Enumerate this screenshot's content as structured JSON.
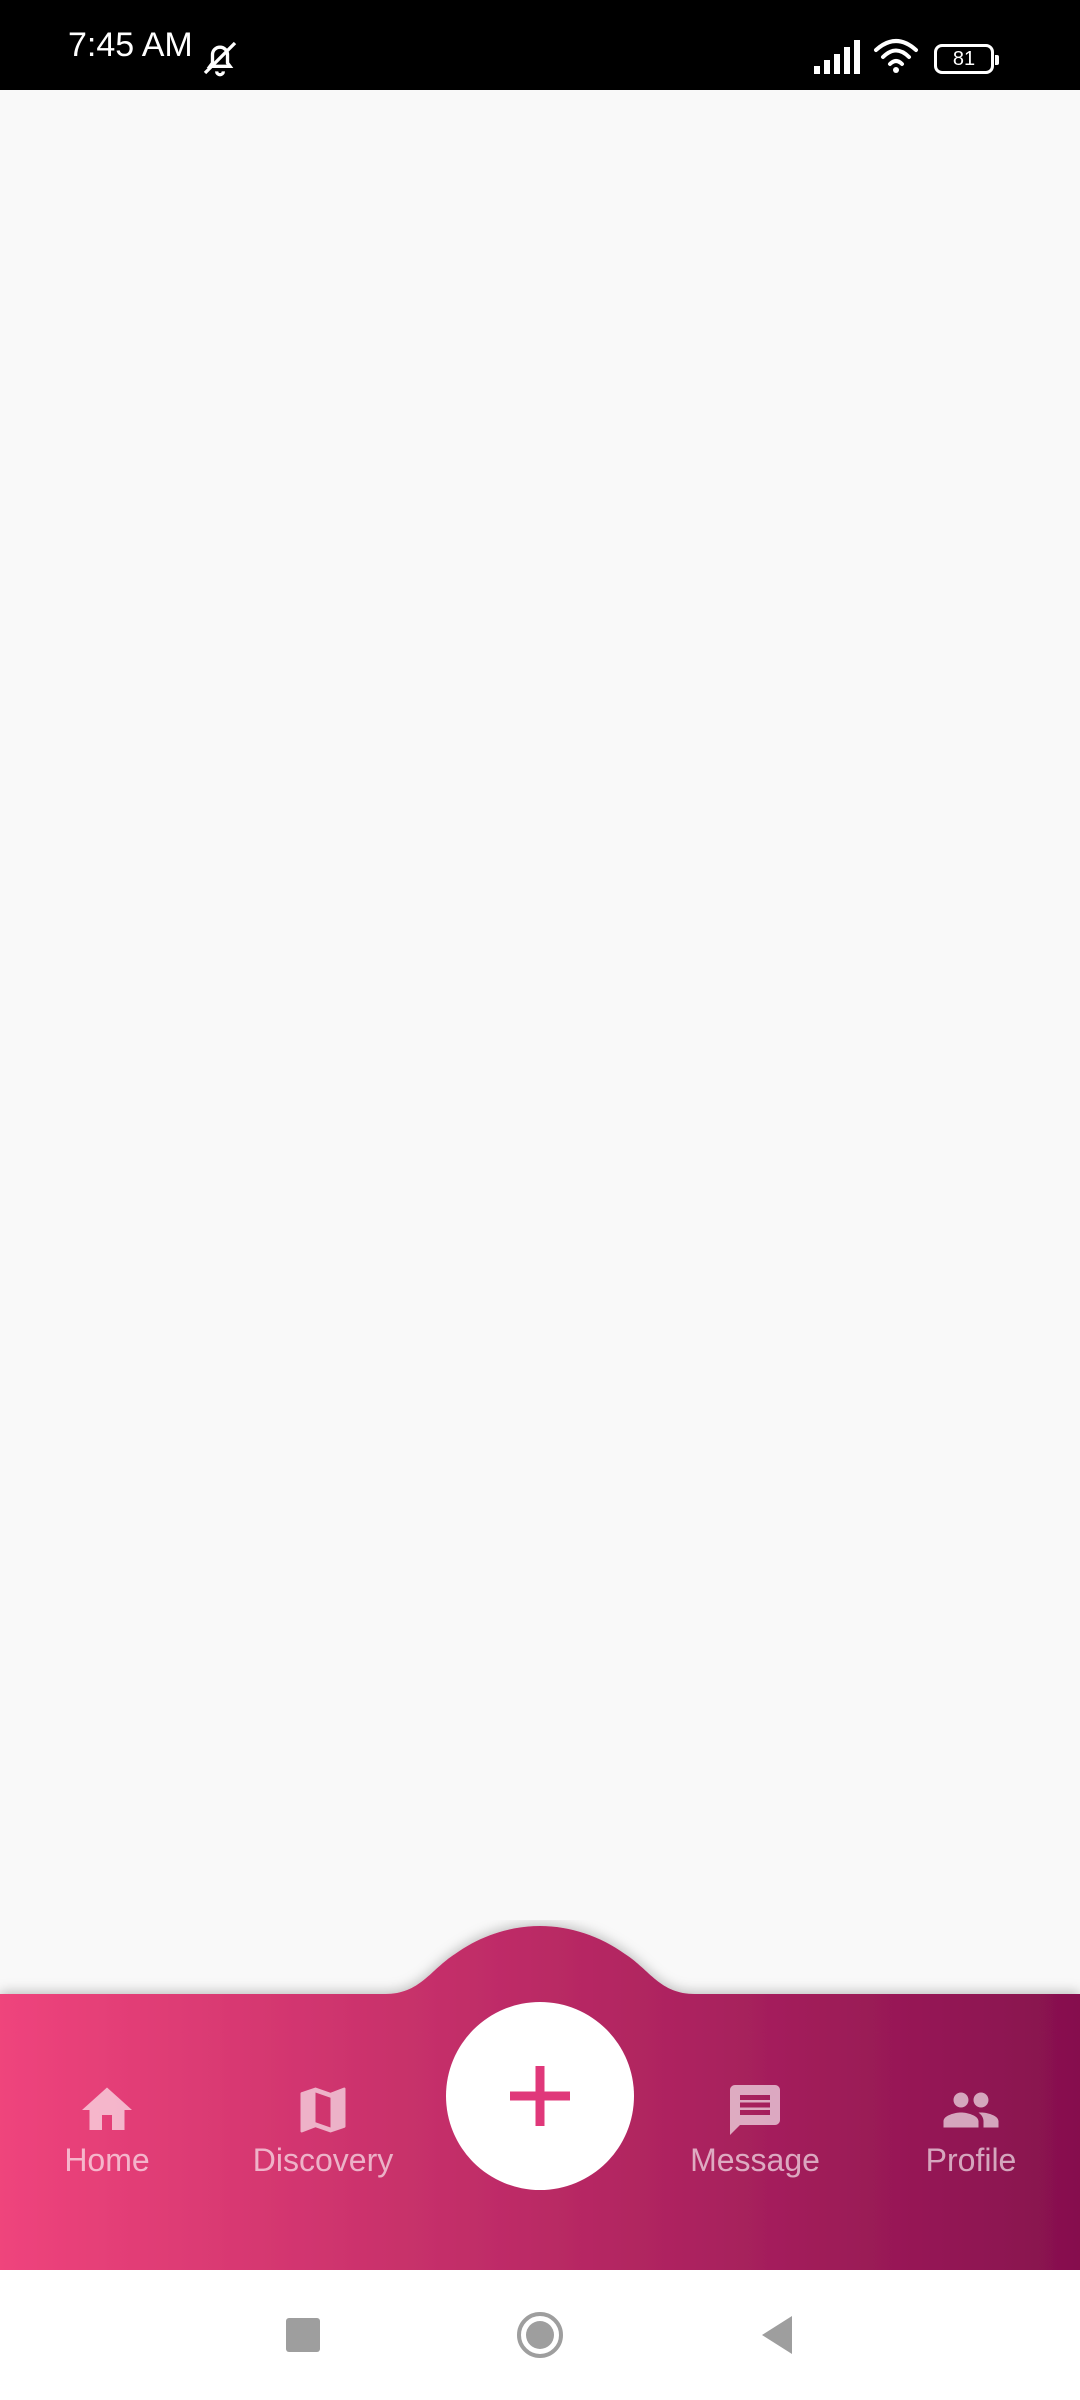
{
  "status_bar": {
    "time": "7:45 AM",
    "battery": "81",
    "icons": [
      "bell-off-icon",
      "signal-icon",
      "wifi-icon",
      "battery-icon"
    ]
  },
  "bottom_nav": {
    "gradient_start": "#ef447c",
    "gradient_end": "#86104e",
    "items": [
      {
        "label": "Home",
        "icon": "home-icon"
      },
      {
        "label": "Discovery",
        "icon": "map-icon"
      },
      {
        "label": "Message",
        "icon": "message-icon"
      },
      {
        "label": "Profile",
        "icon": "people-icon"
      }
    ],
    "fab": {
      "icon": "plus-icon",
      "color": "#e0387a"
    }
  },
  "system_nav": {
    "buttons": [
      "recents-button",
      "home-button",
      "back-button"
    ]
  }
}
